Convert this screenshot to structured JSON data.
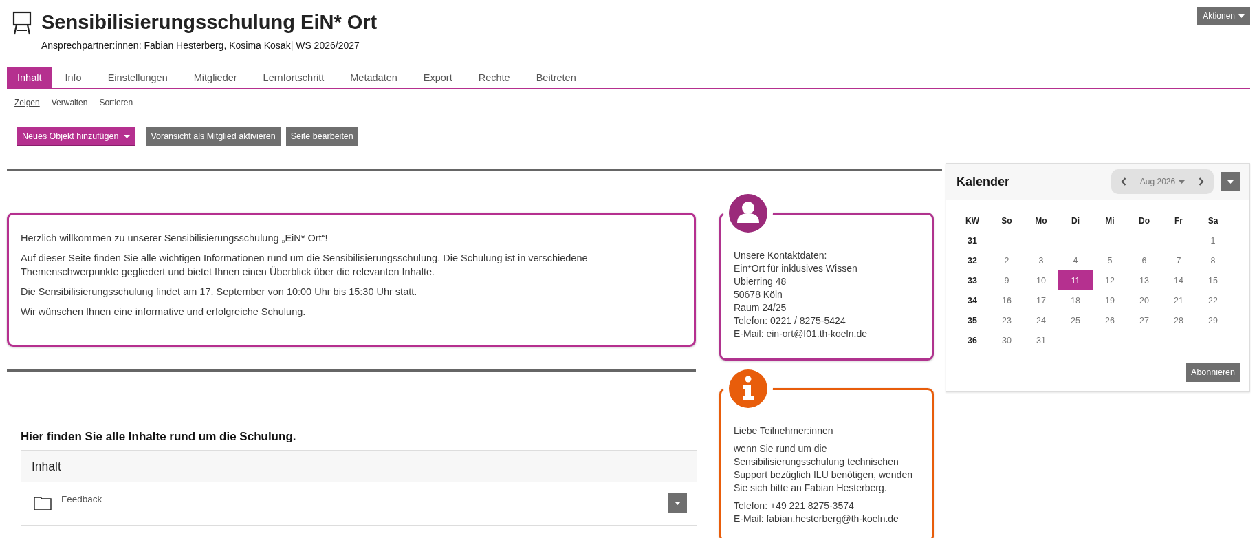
{
  "header": {
    "title": "Sensibilisierungsschulung EiN* Ort",
    "subtitle": "Ansprechpartner:innen: Fabian Hesterberg, Kosima Kosak| WS 2026/2027",
    "actions_button": "Aktionen"
  },
  "tabs": [
    {
      "label": "Inhalt",
      "selected": true
    },
    {
      "label": "Info",
      "selected": false
    },
    {
      "label": "Einstellungen",
      "selected": false
    },
    {
      "label": "Mitglieder",
      "selected": false
    },
    {
      "label": "Lernfortschritt",
      "selected": false
    },
    {
      "label": "Metadaten",
      "selected": false
    },
    {
      "label": "Export",
      "selected": false
    },
    {
      "label": "Rechte",
      "selected": false
    },
    {
      "label": "Beitreten",
      "selected": false
    }
  ],
  "subtabs": [
    {
      "label": "Zeigen",
      "selected": true
    },
    {
      "label": "Verwalten",
      "selected": false
    },
    {
      "label": "Sortieren",
      "selected": false
    }
  ],
  "toolbar": [
    {
      "label": "Neues Objekt hinzufügen",
      "kind": "primary-dropdown"
    },
    {
      "label": "Voransicht als Mitglied aktivieren",
      "kind": "secondary"
    },
    {
      "label": "Seite bearbeiten",
      "kind": "secondary"
    }
  ],
  "welcome": {
    "paragraphs": [
      "Herzlich willkommen zu unserer Sensibilisierungsschulung „EiN* Ort“!",
      "Auf dieser Seite finden Sie alle wichtigen Informationen rund um die Sensibilisierungsschulung. Die Schulung ist in verschiedene Themenschwerpunkte gegliedert und bietet Ihnen einen Überblick über die relevanten Inhalte.",
      "Die Sensibilisierungsschulung findet am 17. September von 10:00 Uhr bis 15:30 Uhr statt.",
      "Wir wünschen Ihnen eine informative und erfolgreiche Schulung."
    ]
  },
  "contact_card": {
    "kind": "person",
    "color": "#b0338e",
    "paragraphs": [
      [
        "Unsere Kontaktdaten:",
        "Ein*Ort für inklusives Wissen",
        "Ubierring 48",
        "50678 Köln",
        "Raum 24/25",
        "Telefon: 0221 / 8275-5424",
        "E-Mail: ein-ort@f01.th-koeln.de"
      ]
    ]
  },
  "info_card": {
    "kind": "info",
    "color": "#e85d0b",
    "paragraphs": [
      [
        "Liebe Teilnehmer:innen"
      ],
      [
        "wenn Sie rund um die Sensibilisierungsschulung technischen Support bezüglich ILU benötigen, wenden Sie sich bitte an Fabian Hesterberg."
      ],
      [
        "Telefon: +49 221 8275-3574",
        "E-Mail: fabian.hesterberg@th-koeln.de"
      ]
    ]
  },
  "content_heading": "Hier finden Sie alle Inhalte rund um die Schulung.",
  "content_panel": {
    "title": "Inhalt",
    "items": [
      {
        "label": "Feedback",
        "kind": "folder"
      }
    ]
  },
  "calendar": {
    "title": "Kalender",
    "month": "Aug 2026",
    "button": "Abonnieren",
    "columns": [
      "KW",
      "So",
      "Mo",
      "Di",
      "Mi",
      "Do",
      "Fr",
      "Sa"
    ],
    "weeks": [
      {
        "kw": "31",
        "days": [
          {
            "label": "1",
            "selected": false
          }
        ]
      },
      {
        "kw": "32",
        "days": [
          {
            "label": "2",
            "selected": false
          },
          {
            "label": "3",
            "selected": false
          },
          {
            "label": "4",
            "selected": false
          },
          {
            "label": "5",
            "selected": false
          },
          {
            "label": "6",
            "selected": false
          },
          {
            "label": "7",
            "selected": false
          },
          {
            "label": "8",
            "selected": false
          }
        ]
      },
      {
        "kw": "33",
        "days": [
          {
            "label": "9",
            "selected": false
          },
          {
            "label": "10",
            "selected": false
          },
          {
            "label": "11",
            "selected": true
          },
          {
            "label": "12",
            "selected": false
          },
          {
            "label": "13",
            "selected": false
          },
          {
            "label": "14",
            "selected": false
          },
          {
            "label": "15",
            "selected": false
          }
        ]
      },
      {
        "kw": "34",
        "days": [
          {
            "label": "16",
            "selected": false
          },
          {
            "label": "17",
            "selected": false
          },
          {
            "label": "18",
            "selected": false
          },
          {
            "label": "19",
            "selected": false
          },
          {
            "label": "20",
            "selected": false
          },
          {
            "label": "21",
            "selected": false
          },
          {
            "label": "22",
            "selected": false
          }
        ]
      },
      {
        "kw": "35",
        "days": [
          {
            "label": "23",
            "selected": false
          },
          {
            "label": "24",
            "selected": false
          },
          {
            "label": "25",
            "selected": false
          },
          {
            "label": "26",
            "selected": false
          },
          {
            "label": "27",
            "selected": false
          },
          {
            "label": "28",
            "selected": false
          },
          {
            "label": "29",
            "selected": false
          }
        ]
      },
      {
        "kw": "36",
        "days": [
          {
            "label": "30",
            "selected": false
          },
          {
            "label": "31",
            "selected": false
          }
        ]
      }
    ]
  }
}
